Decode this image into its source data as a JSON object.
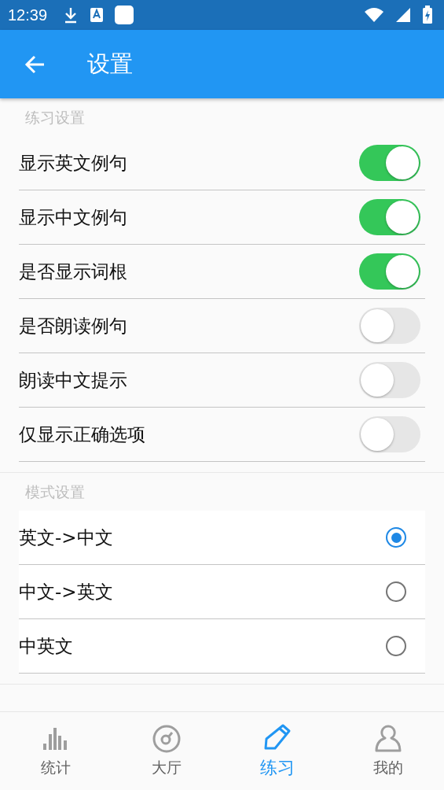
{
  "status_bar": {
    "time": "12:39"
  },
  "app_bar": {
    "title": "设置"
  },
  "sections": [
    {
      "title": "练习设置",
      "kind": "switch",
      "items": [
        {
          "label": "显示英文例句",
          "on": true
        },
        {
          "label": "显示中文例句",
          "on": true
        },
        {
          "label": "是否显示词根",
          "on": true
        },
        {
          "label": "是否朗读例句",
          "on": false
        },
        {
          "label": "朗读中文提示",
          "on": false
        },
        {
          "label": "仅显示正确选项",
          "on": false
        }
      ]
    },
    {
      "title": "模式设置",
      "kind": "radio",
      "items": [
        {
          "label": "英文->中文",
          "selected": true
        },
        {
          "label": "中文->英文",
          "selected": false
        },
        {
          "label": "中英文",
          "selected": false
        }
      ]
    }
  ],
  "bottom_nav": [
    {
      "label": "统计",
      "kind": "chart",
      "selected": false
    },
    {
      "label": "大厅",
      "kind": "gauge",
      "selected": false
    },
    {
      "label": "练习",
      "kind": "pencil",
      "selected": true
    },
    {
      "label": "我的",
      "kind": "person",
      "selected": false
    }
  ]
}
